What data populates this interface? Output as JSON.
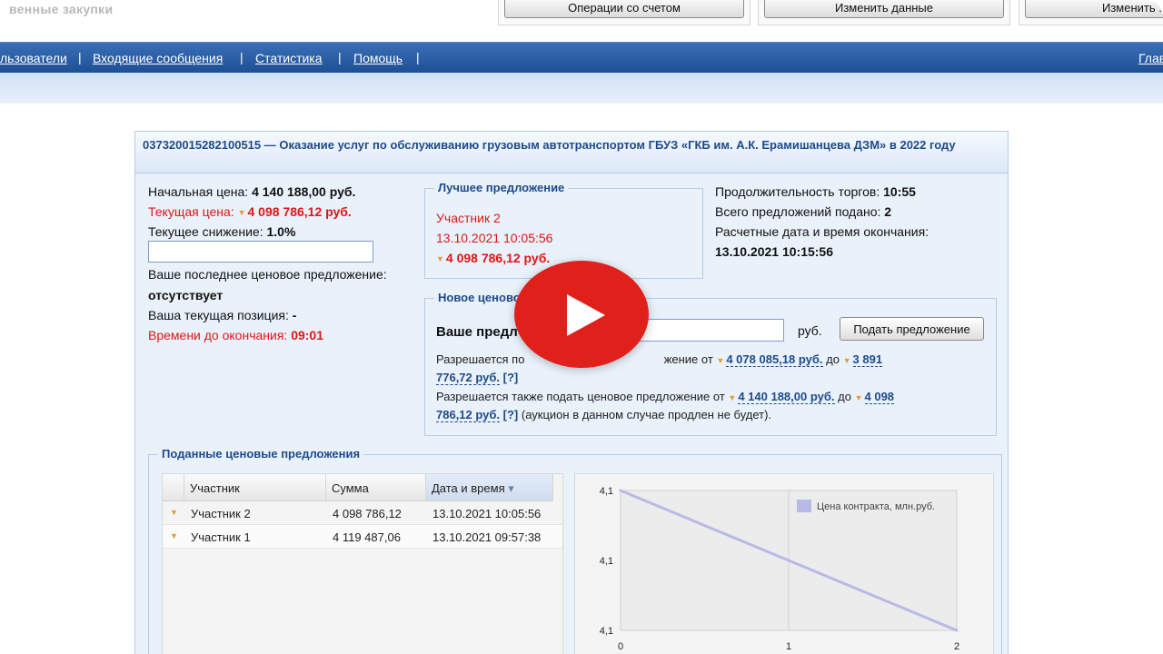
{
  "header": {
    "brand_fragment": "венные закупки",
    "buttons": [
      "Операции со счетом",
      "Изменить данные",
      "Изменить ."
    ]
  },
  "nav": {
    "items": [
      "льзователи",
      "Входящие сообщения",
      "Статистика",
      "Помощь"
    ],
    "separator": "|",
    "right_fragment": "Глав"
  },
  "auction": {
    "title": "037320015282100515 — Оказание услуг по обслуживанию грузовым автотранспортом ГБУЗ «ГКБ им. А.К. Ерамишанцева ДЗМ» в 2022 году",
    "start_price_label": "Начальная цена:",
    "start_price_value": "4 140 188,00 руб.",
    "current_price_label": "Текущая цена:",
    "current_price_value": "4 098 786,12 руб.",
    "reduction_label": "Текущее снижение:",
    "reduction_value": "1.0%",
    "last_offer_label": "Ваше последнее ценовое предложение:",
    "last_offer_value": "отсутствует",
    "position_label": "Ваша текущая позиция:",
    "position_value": "-",
    "time_left_label": "Времени до окончания:",
    "time_left_value": "09:01"
  },
  "best_offer": {
    "legend": "Лучшее предложение",
    "participant": "Участник 2",
    "datetime": "13.10.2021 10:05:56",
    "price": "4 098 786,12 руб."
  },
  "stats": {
    "duration_label": "Продолжительность торгов:",
    "duration_value": "10:55",
    "total_label": "Всего предложений подано:",
    "total_value": "2",
    "end_label": "Расчетные дата и время окончания:",
    "end_value": "13.10.2021 10:15:56"
  },
  "new_offer": {
    "legend_visible": "Новое ценово",
    "field_label_visible": "Ваше предл",
    "help_mark": "[?]",
    "field_tail": ":",
    "currency": "руб.",
    "submit_label": "Подать предложение",
    "allowed_line1_start": "Разрешается по",
    "allowed_line1_mid": "жение от",
    "allowed_range1_from": "4 078 085,18 руб.",
    "word_to": "до",
    "allowed_range1_to_part1": "3 891",
    "allowed_range1_to_part2": "776,72 руб.",
    "allowed_line2_start": "Разрешается также подать ценовое предложение от",
    "allowed_range2_from": "4 140 188,00 руб.",
    "allowed_range2_to_part1": "4 098",
    "allowed_range2_to_part2": "786,12 руб.",
    "allowed_line2_note": "(аукцион в данном случае продлен не будет)."
  },
  "offers": {
    "legend": "Поданные ценовые предложения",
    "columns": [
      "Участник",
      "Сумма",
      "Дата и время"
    ],
    "sort_indicator": "▾",
    "rows": [
      {
        "participant": "Участник 2",
        "sum": "4 098 786,12",
        "datetime": "13.10.2021 10:05:56"
      },
      {
        "participant": "Участник 1",
        "sum": "4 119 487,06",
        "datetime": "13.10.2021 09:57:38"
      }
    ]
  },
  "chart_data": {
    "type": "line",
    "series": [
      {
        "name": "Цена контракта, млн.руб.",
        "x": [
          0,
          2
        ],
        "y": [
          4.14,
          4.099
        ]
      }
    ],
    "x_ticks": [
      "0",
      "1",
      "2"
    ],
    "y_ticks": [
      "4,1",
      "4,1",
      "4,1"
    ],
    "xlim": [
      0,
      2
    ],
    "grid": true,
    "legend_position": "top-right",
    "line_color": "#b9b9e6"
  },
  "colors": {
    "navbar": "#1d4f95",
    "accent_red": "#e01616",
    "link_blue": "#1e4a8c",
    "play_red": "#e0211b"
  }
}
